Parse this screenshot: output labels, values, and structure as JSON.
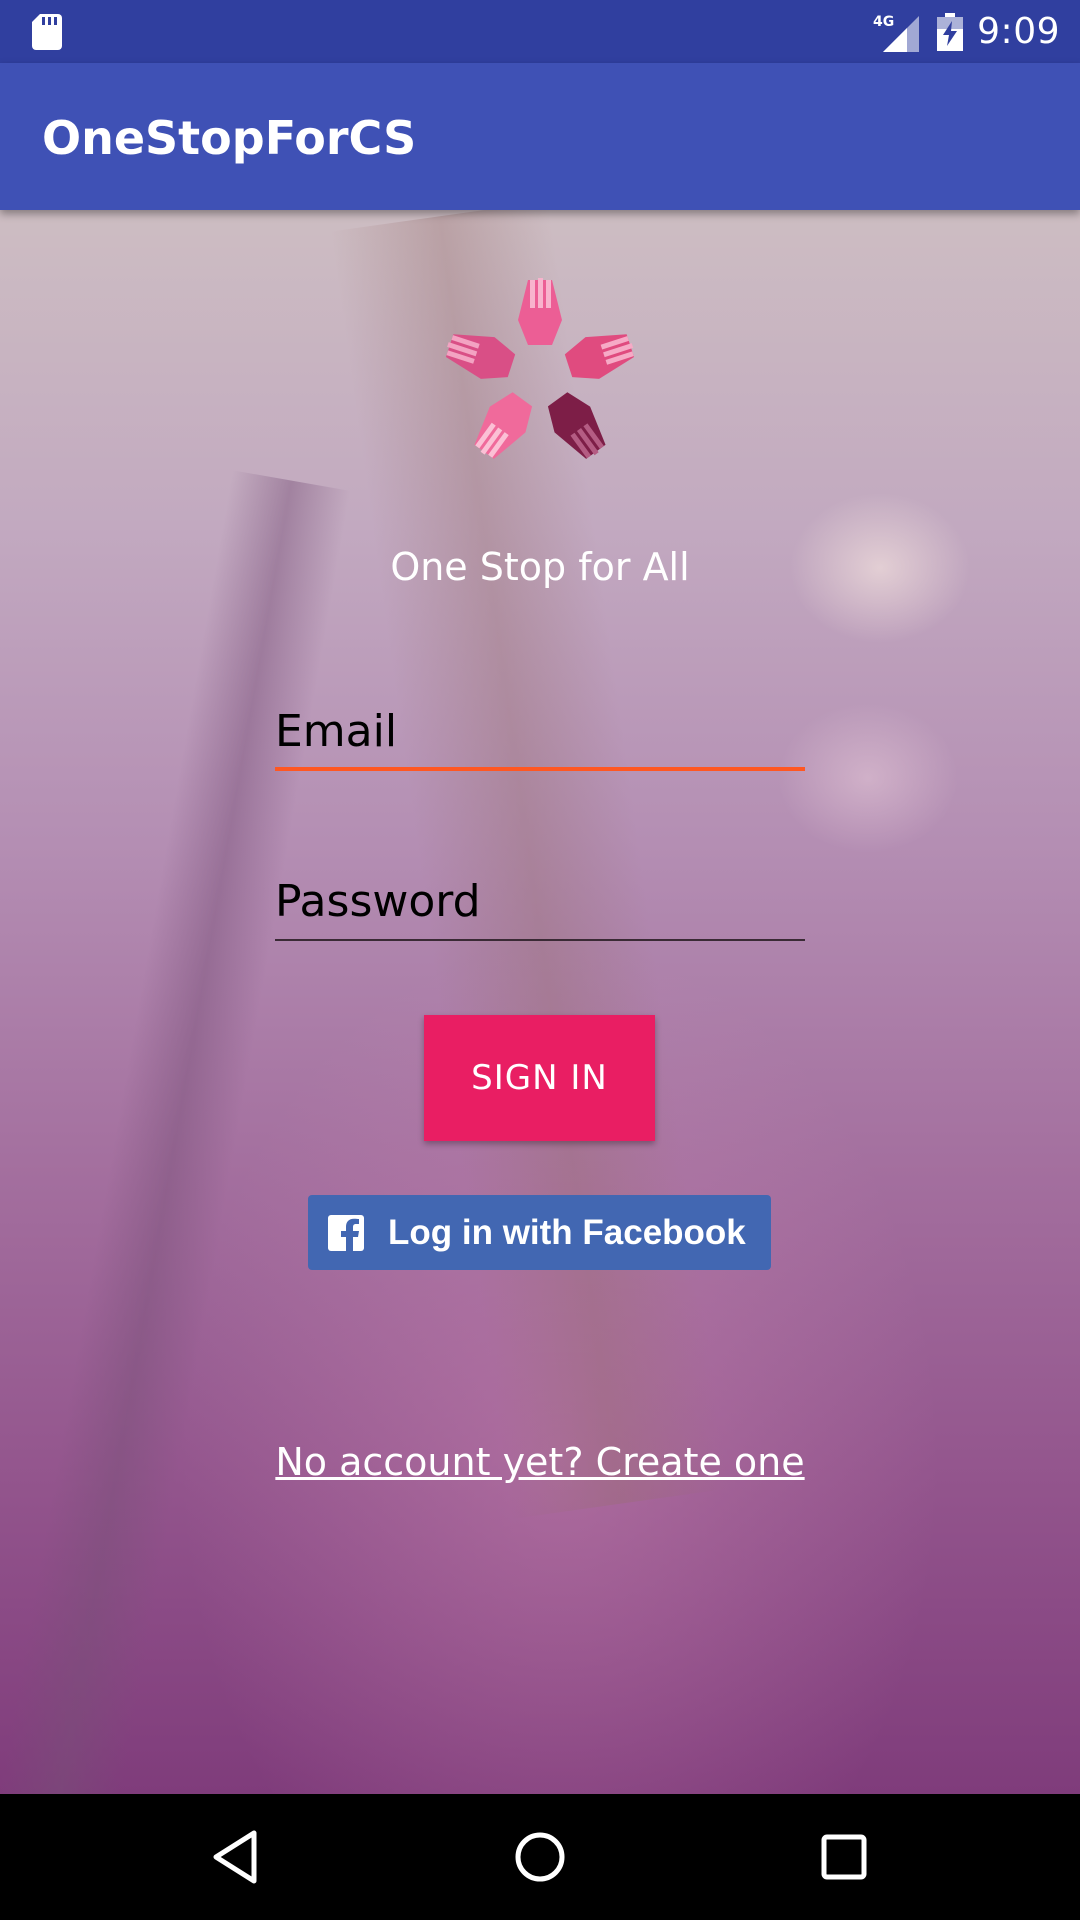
{
  "status_bar": {
    "time": "9:09",
    "network_label": "4G",
    "icons": [
      "sd-card-icon",
      "signal-4g-icon",
      "battery-charging-icon"
    ]
  },
  "app_bar": {
    "title": "OneStopForCS"
  },
  "main": {
    "logo_icon": "hands-star-logo",
    "tagline": "One Stop for All",
    "email_field": {
      "placeholder": "Email",
      "value": ""
    },
    "password_field": {
      "placeholder": "Password",
      "value": ""
    },
    "signin_label": "SIGN IN",
    "facebook_label": "Log in with Facebook",
    "create_account_link": "No account yet? Create one"
  },
  "nav_bar": {
    "buttons": [
      "back-icon",
      "home-icon",
      "recents-icon"
    ]
  },
  "colors": {
    "status_bar": "#303f9f",
    "app_bar": "#3f51b5",
    "accent_underline": "#ff5722",
    "signin_button": "#e91e63",
    "facebook_button": "#4267b2"
  }
}
